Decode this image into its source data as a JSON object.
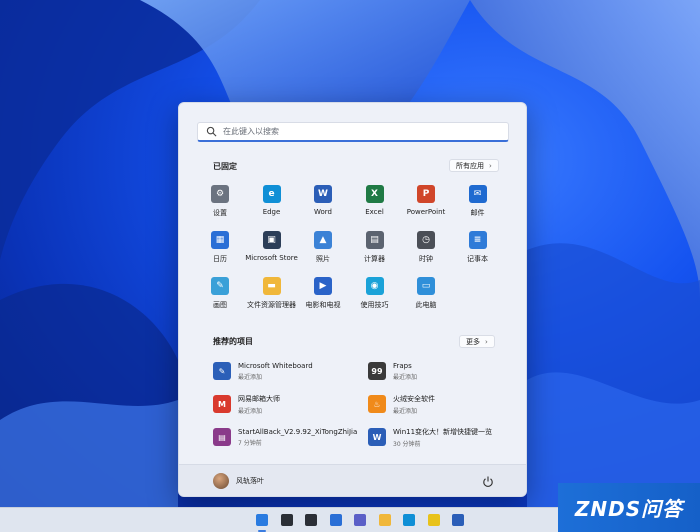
{
  "search": {
    "placeholder": "在此键入以搜索"
  },
  "pinned": {
    "title": "已固定",
    "all_apps_label": "所有应用",
    "apps": [
      {
        "label": "设置",
        "icon": "gear-icon",
        "color": "#6b7380"
      },
      {
        "label": "Edge",
        "icon": "edge-icon",
        "color": "#0f8fd6"
      },
      {
        "label": "Word",
        "icon": "word-icon",
        "color": "#2b5eb7"
      },
      {
        "label": "Excel",
        "icon": "excel-icon",
        "color": "#1f7a45"
      },
      {
        "label": "PowerPoint",
        "icon": "powerpoint-icon",
        "color": "#d0462a"
      },
      {
        "label": "邮件",
        "icon": "mail-icon",
        "color": "#1f6ad0"
      },
      {
        "label": "日历",
        "icon": "calendar-icon",
        "color": "#2a6fd6"
      },
      {
        "label": "Microsoft Store",
        "icon": "store-icon",
        "color": "#2c3e58"
      },
      {
        "label": "照片",
        "icon": "photos-icon",
        "color": "#3b82d6"
      },
      {
        "label": "计算器",
        "icon": "calculator-icon",
        "color": "#5b6370"
      },
      {
        "label": "时钟",
        "icon": "clock-icon",
        "color": "#4b4f57"
      },
      {
        "label": "记事本",
        "icon": "notepad-icon",
        "color": "#2f7bd8"
      },
      {
        "label": "画图",
        "icon": "paint-icon",
        "color": "#3aa0d8"
      },
      {
        "label": "文件资源管理器",
        "icon": "folder-icon",
        "color": "#f0b73a"
      },
      {
        "label": "电影和电视",
        "icon": "movies-icon",
        "color": "#2a63c8"
      },
      {
        "label": "使用技巧",
        "icon": "tips-icon",
        "color": "#1aa2d8"
      },
      {
        "label": "此电脑",
        "icon": "this-pc-icon",
        "color": "#2f8fd9"
      }
    ]
  },
  "recommended": {
    "title": "推荐的项目",
    "more_label": "更多",
    "items": [
      {
        "name": "Microsoft Whiteboard",
        "sub": "最近添加",
        "icon": "whiteboard-icon",
        "color": "#2b5fb8"
      },
      {
        "name": "Fraps",
        "sub": "最近添加",
        "icon": "fraps-icon",
        "color": "#3a3a3a"
      },
      {
        "name": "网易邮箱大师",
        "sub": "最近添加",
        "icon": "netease-mail-icon",
        "color": "#d93a2e"
      },
      {
        "name": "火绒安全软件",
        "sub": "最近添加",
        "icon": "huorong-icon",
        "color": "#f08a1a"
      },
      {
        "name": "StartAllBack_V2.9.92_XiTongZhiJia",
        "sub": "7 分钟前",
        "icon": "winrar-icon",
        "color": "#8a3a8a"
      },
      {
        "name": "Win11变化大！新增快捷键一览",
        "sub": "30 分钟前",
        "icon": "word-doc-icon",
        "color": "#2b5eb7"
      }
    ]
  },
  "user": {
    "name": "风轨落叶"
  },
  "watermark": {
    "text": "ZNDS问答"
  },
  "taskbar": {
    "icons": [
      {
        "name": "start-icon",
        "color": "#2a7be0"
      },
      {
        "name": "search-icon",
        "color": "#2b2f36"
      },
      {
        "name": "task-view-icon",
        "color": "#2b2f36"
      },
      {
        "name": "widgets-icon",
        "color": "#2a6fd6"
      },
      {
        "name": "chat-icon",
        "color": "#5b5fc7"
      },
      {
        "name": "folder-icon",
        "color": "#f0b73a"
      },
      {
        "name": "edge-icon",
        "color": "#0f8fd6"
      },
      {
        "name": "music-icon",
        "color": "#e8c21a"
      },
      {
        "name": "word-icon",
        "color": "#2b5eb7"
      }
    ]
  }
}
